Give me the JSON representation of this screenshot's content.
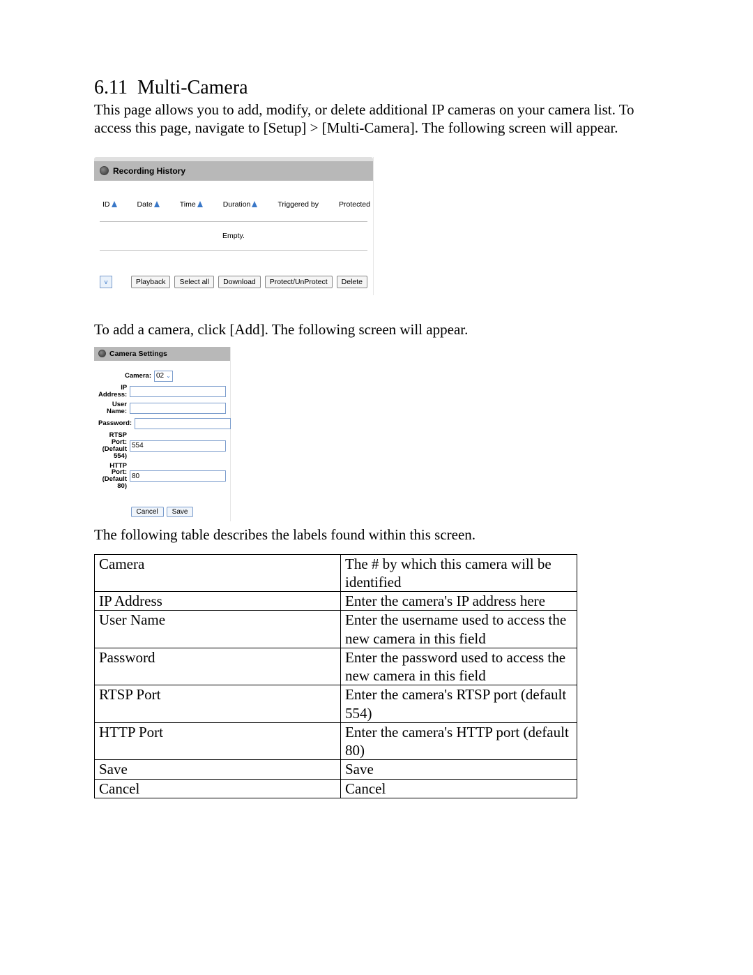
{
  "section": {
    "number": "6.11",
    "title": "Multi-Camera",
    "intro": "This page allows you to add, modify, or delete additional IP cameras on your camera list. To access this page, navigate to [Setup] > [Multi-Camera]. The following screen will appear.",
    "mid_text": "To add a camera, click [Add]. The following screen will appear.",
    "table_intro": "The following table describes the labels found within this screen."
  },
  "recording_panel": {
    "title": "Recording History",
    "columns": {
      "id": "ID",
      "date": "Date",
      "time": "Time",
      "duration": "Duration",
      "triggered": "Triggered by",
      "protected": "Protected"
    },
    "empty_text": "Empty.",
    "dropdown_icon": "v",
    "buttons": {
      "playback": "Playback",
      "select_all": "Select all",
      "download": "Download",
      "protect": "Protect/UnProtect",
      "delete": "Delete"
    }
  },
  "camera_panel": {
    "title": "Camera Settings",
    "fields": {
      "camera_label": "Camera:",
      "camera_value": "02",
      "ip_label": "IP Address:",
      "ip_value": "",
      "user_label": "User Name:",
      "user_value": "",
      "pass_label": "Password:",
      "pass_value": "",
      "rtsp_label": "RTSP Port: (Default 554)",
      "rtsp_value": "554",
      "http_label": "HTTP Port: (Default 80)",
      "http_value": "80"
    },
    "buttons": {
      "cancel": "Cancel",
      "save": "Save"
    }
  },
  "desc_table": {
    "rows": [
      {
        "label": "Camera",
        "desc": "The # by which this camera will be identified"
      },
      {
        "label": "IP Address",
        "desc": "Enter the camera's IP address here"
      },
      {
        "label": "User Name",
        "desc": "Enter the username used to access the new camera in this field"
      },
      {
        "label": "Password",
        "desc": "Enter the password used to access the new camera in this field"
      },
      {
        "label": "RTSP Port",
        "desc": "Enter the camera's RTSP port (default 554)"
      },
      {
        "label": "HTTP Port",
        "desc": "Enter the camera's HTTP port (default 80)"
      },
      {
        "label": "Save",
        "desc": "Save"
      },
      {
        "label": "Cancel",
        "desc": "Cancel"
      }
    ]
  }
}
